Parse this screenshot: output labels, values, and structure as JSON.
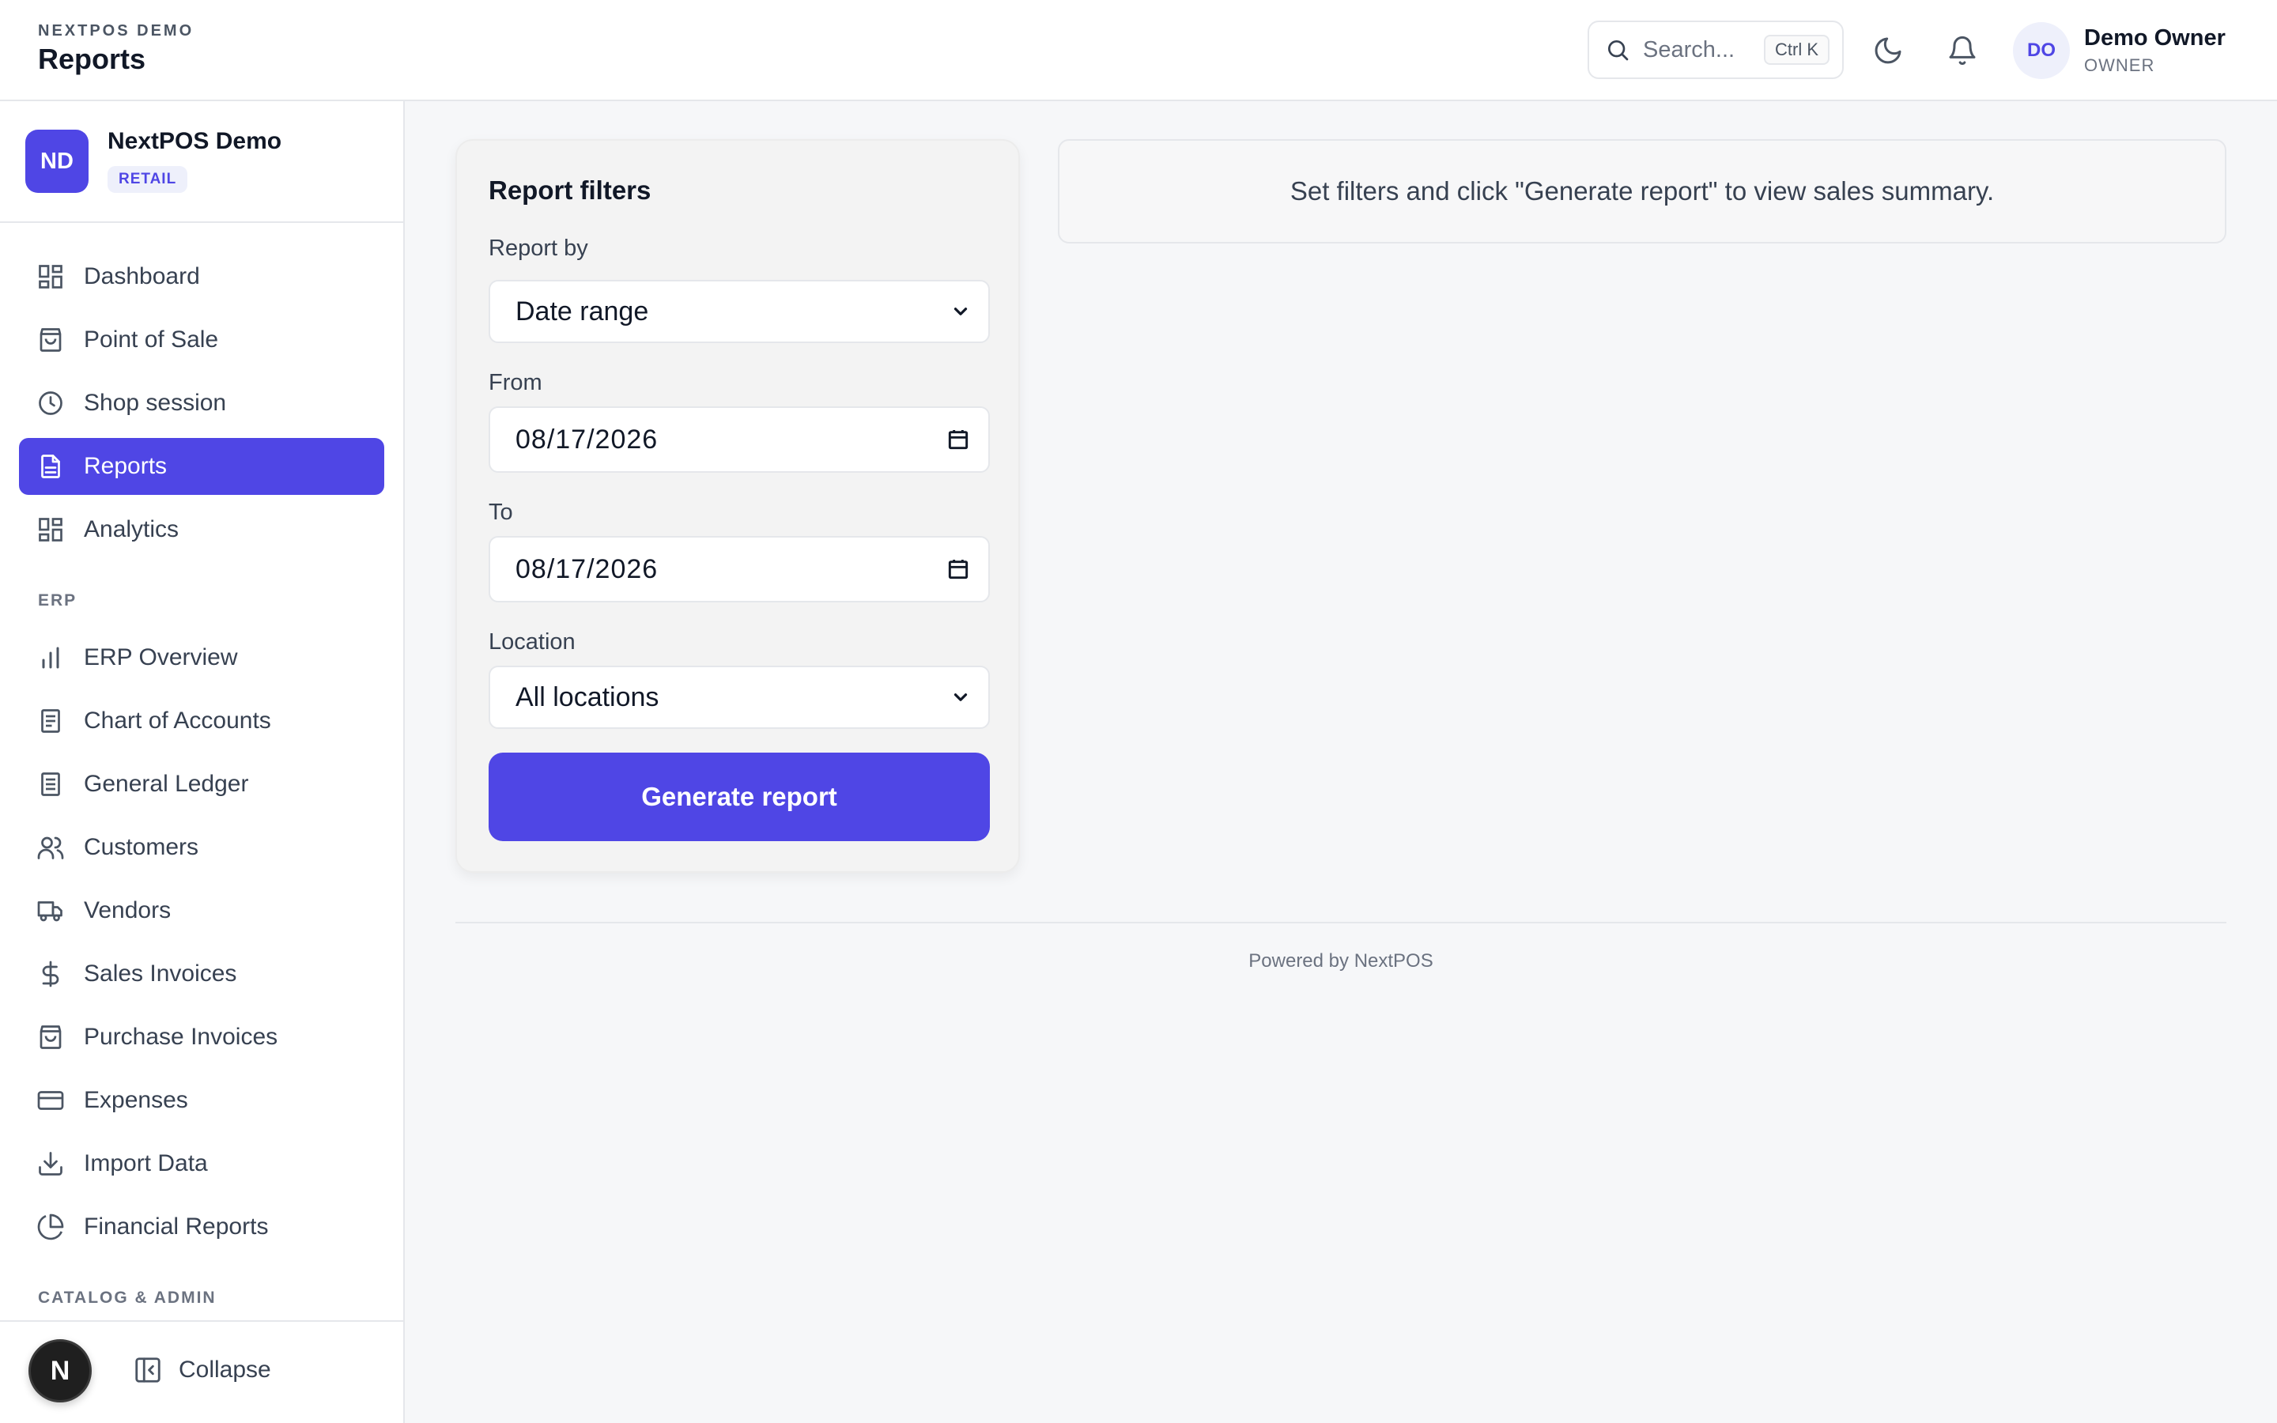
{
  "header": {
    "org_label": "NEXTPOS DEMO",
    "page_title": "Reports",
    "search_placeholder": "Search...",
    "search_shortcut": "Ctrl K",
    "theme_icon": "moon-icon",
    "notification_icon": "bell-icon",
    "user_initials": "DO",
    "user_name": "Demo Owner",
    "user_role": "OWNER"
  },
  "sidebar": {
    "org_initials": "ND",
    "org_name": "NextPOS Demo",
    "org_badge": "RETAIL",
    "items": [
      {
        "label": "Dashboard",
        "icon": "dashboard-icon"
      },
      {
        "label": "Point of Sale",
        "icon": "shopping-bag-icon"
      },
      {
        "label": "Shop session",
        "icon": "clock-icon"
      },
      {
        "label": "Reports",
        "icon": "file-text-icon",
        "active": true
      },
      {
        "label": "Analytics",
        "icon": "dashboard-icon"
      }
    ],
    "erp_section": "ERP",
    "erp_items": [
      {
        "label": "ERP Overview",
        "icon": "bar-chart-icon"
      },
      {
        "label": "Chart of Accounts",
        "icon": "book-icon"
      },
      {
        "label": "General Ledger",
        "icon": "ledger-icon"
      },
      {
        "label": "Customers",
        "icon": "users-icon"
      },
      {
        "label": "Vendors",
        "icon": "truck-icon"
      },
      {
        "label": "Sales Invoices",
        "icon": "dollar-icon"
      },
      {
        "label": "Purchase Invoices",
        "icon": "shopping-bag-icon"
      },
      {
        "label": "Expenses",
        "icon": "credit-card-icon"
      },
      {
        "label": "Import Data",
        "icon": "download-icon"
      },
      {
        "label": "Financial Reports",
        "icon": "pie-chart-icon"
      }
    ],
    "catalog_section": "CATALOG & ADMIN",
    "footer_avatar": "N",
    "collapse_label": "Collapse"
  },
  "filters": {
    "title": "Report filters",
    "report_by_label": "Report by",
    "report_by_value": "Date range",
    "from_label": "From",
    "from_value": "08/17/2026",
    "to_label": "To",
    "to_value": "08/17/2026",
    "location_label": "Location",
    "location_value": "All locations",
    "generate_label": "Generate report"
  },
  "info_message": "Set filters and click \"Generate report\" to view sales summary.",
  "footer": {
    "powered_by": "Powered by NextPOS"
  },
  "colors": {
    "accent": "#4f46e5",
    "background": "#f6f7f9"
  }
}
